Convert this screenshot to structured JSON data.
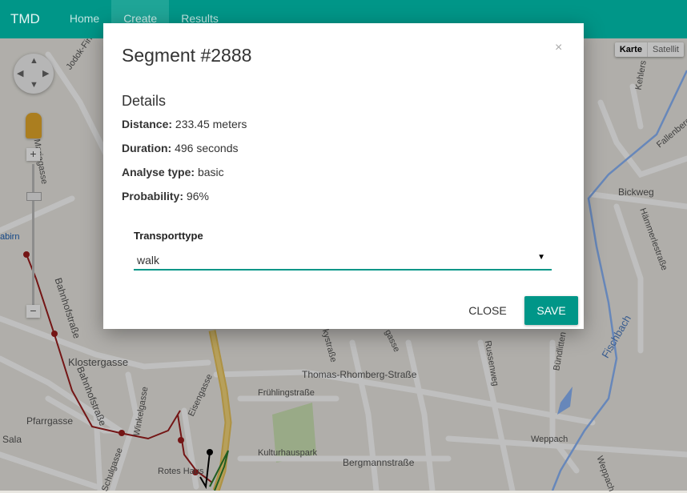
{
  "navbar": {
    "brand": "TMD",
    "items": [
      {
        "label": "Home",
        "active": false
      },
      {
        "label": "Create",
        "active": true
      },
      {
        "label": "Results",
        "active": false
      }
    ],
    "color": "#009688"
  },
  "map": {
    "type_control": {
      "selected": "Karte",
      "other": "Satellit"
    },
    "labels": {
      "jodok": "Jodok-Fink",
      "maria": "Mariagasse",
      "bahnhof": "Bahnhofstraße",
      "bahnhof2": "Bahnhofstraße",
      "kloster": "Klostergasse",
      "pfarr": "Pfarrgasse",
      "sala": "Sala",
      "schulgasse": "Schulgasse",
      "winkel": "Winkelgasse",
      "eisen": "Eisengasse",
      "rotes": "Rotes Haus",
      "thomas": "Thomas-Rhomberg-Straße",
      "fruehling": "Frühlingstraße",
      "kultur": "Kulturhauspark",
      "bergmann": "Bergmannstraße",
      "weppach": "Weppach",
      "weppach2": "Weppach",
      "fischbach": "Fischbach",
      "bickweg": "Bickweg",
      "fallenberg": "Fallenberga",
      "haemmerle": "Hämmerlestraße",
      "kehlers": "Kehlers",
      "russen": "Russenweg",
      "buendlitten": "Bündlitten",
      "gasse": "gasse",
      "kystrasse": "kystraße",
      "bahn_stop": "abirn"
    }
  },
  "modal": {
    "title": "Segment #2888",
    "close_icon": "×",
    "details_heading": "Details",
    "details": [
      {
        "label": "Distance:",
        "value": "233.45 meters"
      },
      {
        "label": "Duration:",
        "value": "496 seconds"
      },
      {
        "label": "Analyse type:",
        "value": "basic"
      },
      {
        "label": "Probability:",
        "value": "96%"
      }
    ],
    "transport_label": "Transporttype",
    "transport_value": "walk",
    "caret": "▼",
    "close_button": "CLOSE",
    "save_button": "SAVE"
  }
}
